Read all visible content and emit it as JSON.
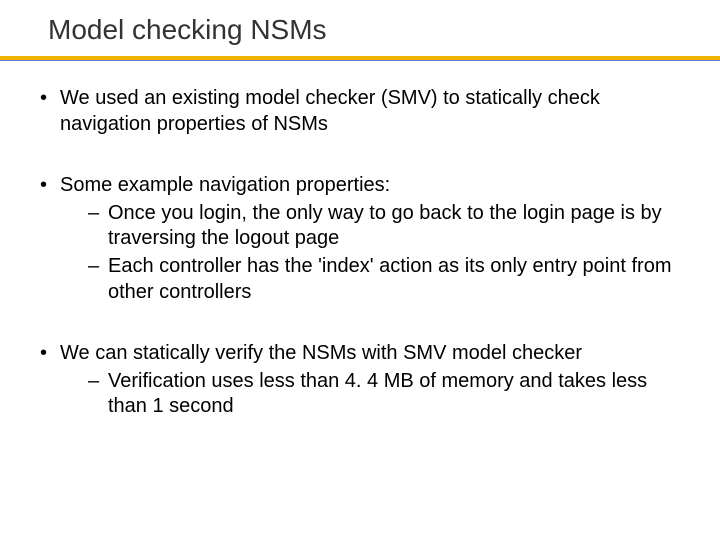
{
  "title": "Model checking NSMs",
  "bullets": [
    {
      "text": "We used an existing model checker (SMV) to statically check navigation properties of NSMs",
      "sub": []
    },
    {
      "text": "Some example navigation properties:",
      "sub": [
        "Once you login, the only way to go back to the login page is by traversing the logout page",
        "Each controller has the 'index' action as its only entry point from other controllers"
      ]
    },
    {
      "text": "We can statically verify the NSMs with SMV model checker",
      "sub": [
        "Verification uses less than 4. 4 MB of memory and takes less than 1 second"
      ]
    }
  ]
}
